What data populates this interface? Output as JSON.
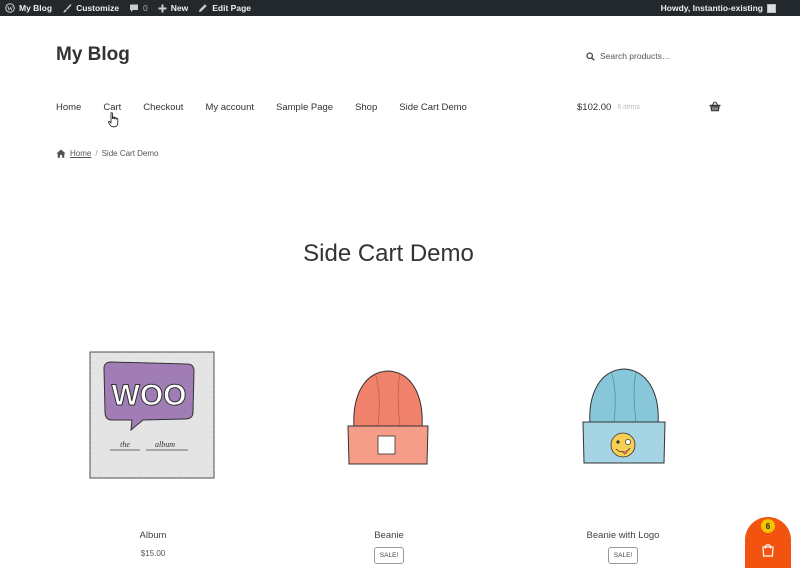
{
  "admin_bar": {
    "site_name": "My Blog",
    "customize": "Customize",
    "comments_count": "0",
    "new_label": "New",
    "edit_page": "Edit Page",
    "howdy": "Howdy, Instantio-existing"
  },
  "header": {
    "site_title": "My Blog",
    "search_placeholder": "Search products…",
    "nav": [
      "Home",
      "Cart",
      "Checkout",
      "My account",
      "Sample Page",
      "Shop",
      "Side Cart Demo"
    ],
    "cart_total": "$102.00",
    "cart_items": "6 items"
  },
  "breadcrumb": {
    "home": "Home",
    "separator": "/",
    "current": "Side Cart Demo"
  },
  "page_title": "Side Cart Demo",
  "products": [
    {
      "name": "Album",
      "price": "$15.00",
      "badge": ""
    },
    {
      "name": "Beanie",
      "price": "",
      "badge": "SALE!"
    },
    {
      "name": "Beanie with Logo",
      "price": "",
      "badge": "SALE!"
    }
  ],
  "album_art": {
    "word": "WOO",
    "caption_left": "the",
    "caption_right": "album"
  },
  "side_cart": {
    "count": "6"
  },
  "colors": {
    "admin_bar": "#23282d",
    "side_cart": "#f2540f",
    "badge": "#f5c400"
  }
}
